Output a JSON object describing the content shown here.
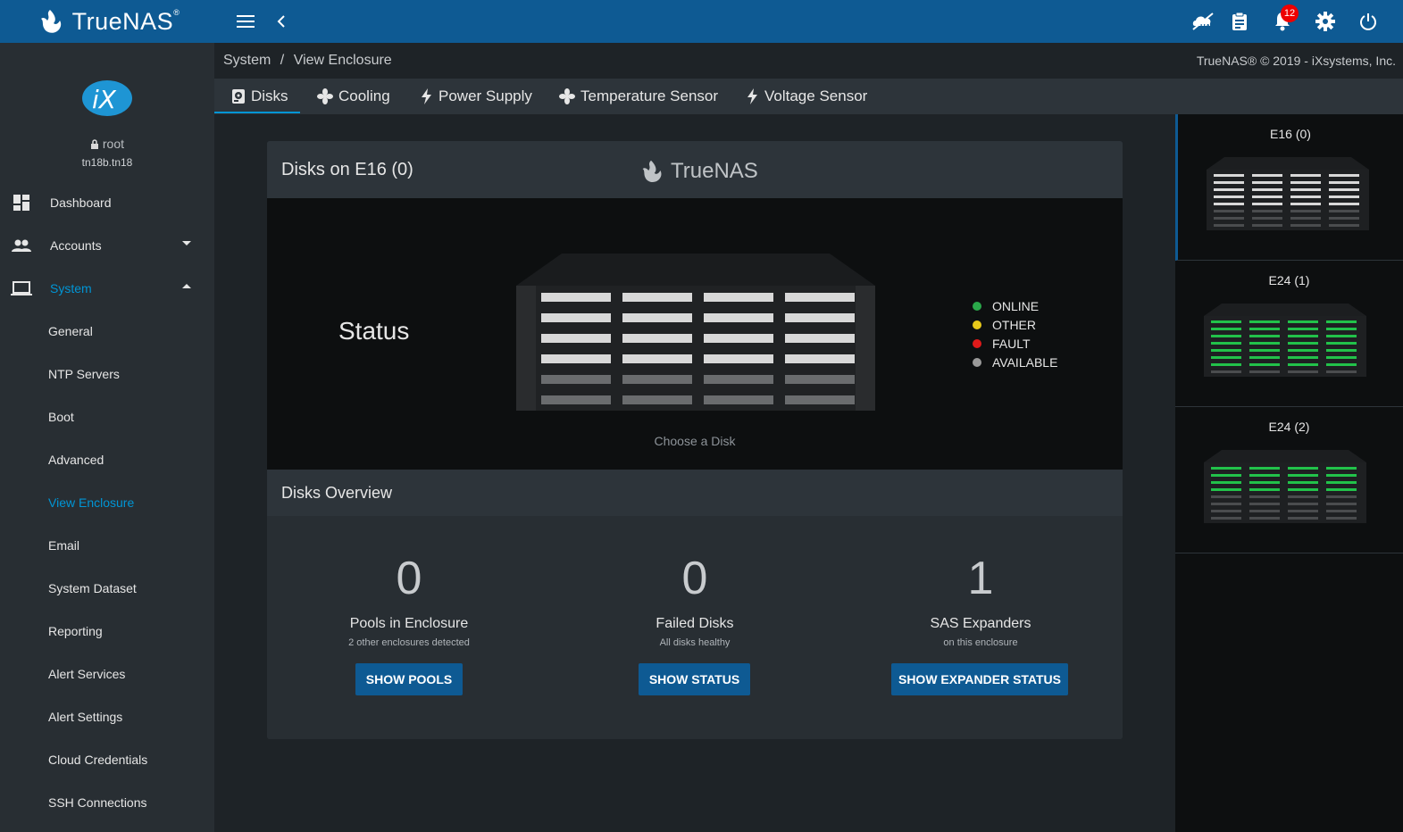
{
  "topbar": {
    "brand": "TrueNAS",
    "brand_mark": "®",
    "notifications_count": "12",
    "icons": [
      "menu-icon",
      "back-icon",
      "ha-status-icon",
      "tasks-icon",
      "notifications-icon",
      "settings-icon",
      "power-icon"
    ]
  },
  "sidebar": {
    "user": "root",
    "hostname": "tn18b.tn18",
    "nav": [
      {
        "label": "Dashboard",
        "icon": "dashboard-icon"
      },
      {
        "label": "Accounts",
        "icon": "accounts-icon"
      },
      {
        "label": "System",
        "icon": "laptop-icon"
      }
    ],
    "system_items": [
      "General",
      "NTP Servers",
      "Boot",
      "Advanced",
      "View Enclosure",
      "Email",
      "System Dataset",
      "Reporting",
      "Alert Services",
      "Alert Settings",
      "Cloud Credentials",
      "SSH Connections"
    ]
  },
  "breadcrumb": {
    "parent": "System",
    "separator": "/",
    "current": "View Enclosure"
  },
  "copyright": "TrueNAS® © 2019 - iXsystems, Inc.",
  "tabs": [
    {
      "label": "Disks",
      "icon": "disk-icon"
    },
    {
      "label": "Cooling",
      "icon": "fan-icon"
    },
    {
      "label": "Power Supply",
      "icon": "bolt-icon"
    },
    {
      "label": "Temperature Sensor",
      "icon": "fan-icon"
    },
    {
      "label": "Voltage Sensor",
      "icon": "bolt-icon"
    }
  ],
  "card": {
    "title": "Disks on E16 (0)",
    "logo": "TrueNAS",
    "status_label": "Status",
    "hint": "Choose a Disk",
    "legend": [
      {
        "label": "ONLINE",
        "color": "#2aa84a"
      },
      {
        "label": "OTHER",
        "color": "#e8c91a"
      },
      {
        "label": "FAULT",
        "color": "#e01a1a"
      },
      {
        "label": "AVAILABLE",
        "color": "#9a9a9a"
      }
    ]
  },
  "overview": {
    "title": "Disks Overview",
    "cells": [
      {
        "value": "0",
        "label": "Pools in Enclosure",
        "sub": "2 other enclosures detected",
        "button": "SHOW POOLS"
      },
      {
        "value": "0",
        "label": "Failed Disks",
        "sub": "All disks healthy",
        "button": "SHOW STATUS"
      },
      {
        "value": "1",
        "label": "SAS Expanders",
        "sub": "on this enclosure",
        "button": "SHOW EXPANDER STATUS"
      }
    ]
  },
  "enclosures": [
    {
      "label": "E16 (0)",
      "selected": true,
      "tray_color": "#d8d8d8"
    },
    {
      "label": "E24 (1)",
      "selected": false,
      "tray_color": "#22c24a"
    },
    {
      "label": "E24 (2)",
      "selected": false,
      "tray_color": "#22c24a"
    }
  ]
}
